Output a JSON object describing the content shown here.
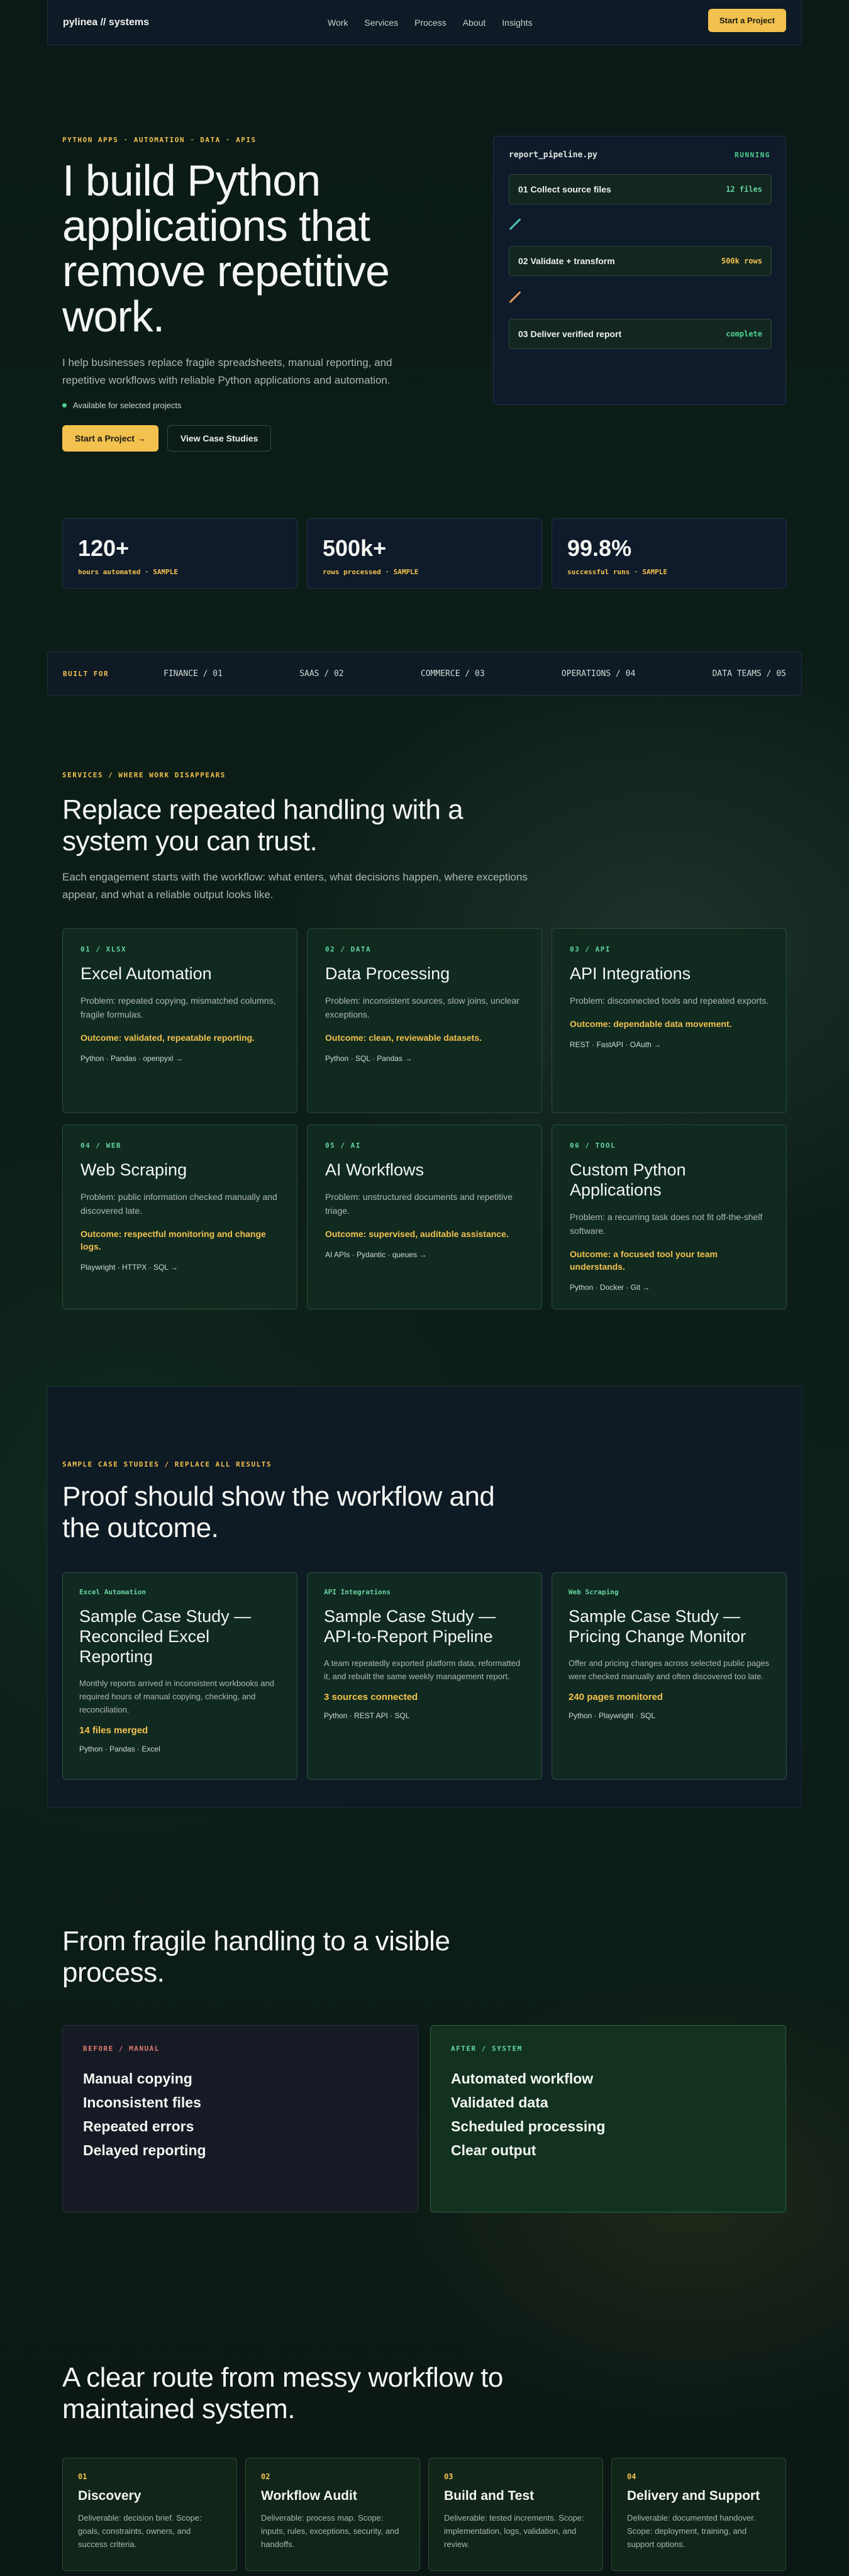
{
  "nav": {
    "brand": "pylinea // systems",
    "links": [
      "Work",
      "Services",
      "Process",
      "About",
      "Insights"
    ],
    "cta": "Start a Project"
  },
  "hero": {
    "eyebrow": "PYTHON APPS · AUTOMATION · DATA · APIS",
    "title": "I build Python applications that remove repetitive work.",
    "lead": "I help businesses replace fragile spreadsheets, manual reporting, and repetitive workflows with reliable Python applications and automation.",
    "availability": "Available for selected projects",
    "cta_primary": "Start a Project →",
    "cta_secondary": "View Case Studies"
  },
  "pipeline": {
    "filename": "report_pipeline.py",
    "status": "RUNNING",
    "steps": [
      {
        "label": "01 Collect source files",
        "meta": "12 files",
        "color": "#64d4a0"
      },
      {
        "label": "02 Validate + transform",
        "meta": "500k rows",
        "color": "#f2c14e"
      },
      {
        "label": "03 Deliver verified report",
        "meta": "complete",
        "color": "#4fd28f"
      }
    ],
    "connector_colors": [
      "#4fc6b6",
      "#e39a5a"
    ]
  },
  "stats": [
    {
      "value": "120+",
      "label": "hours automated · SAMPLE"
    },
    {
      "value": "500k+",
      "label": "rows processed · SAMPLE"
    },
    {
      "value": "99.8%",
      "label": "successful runs · SAMPLE"
    }
  ],
  "built_for": {
    "label": "BUILT FOR",
    "items": [
      "FINANCE / 01",
      "SAAS / 02",
      "COMMERCE / 03",
      "OPERATIONS / 04",
      "DATA TEAMS / 05"
    ]
  },
  "services_section": {
    "eyebrow": "SERVICES / WHERE WORK DISAPPEARS",
    "title": "Replace repeated handling with a system you can trust.",
    "lead": "Each engagement starts with the workflow: what enters, what decisions happen, where exceptions appear, and what a reliable output looks like.",
    "cards": [
      {
        "num": "01 / XLSX",
        "title": "Excel Automation",
        "problem": "Problem: repeated copying, mismatched columns, fragile formulas.",
        "outcome": "Outcome: validated, repeatable reporting.",
        "stack": "Python · Pandas · openpyxl →"
      },
      {
        "num": "02 / DATA",
        "title": "Data Processing",
        "problem": "Problem: inconsistent sources, slow joins, unclear exceptions.",
        "outcome": "Outcome: clean, reviewable datasets.",
        "stack": "Python · SQL · Pandas →"
      },
      {
        "num": "03 / API",
        "title": "API Integrations",
        "problem": "Problem: disconnected tools and repeated exports.",
        "outcome": "Outcome: dependable data movement.",
        "stack": "REST · FastAPI · OAuth →"
      },
      {
        "num": "04 / WEB",
        "title": "Web Scraping",
        "problem": "Problem: public information checked manually and discovered late.",
        "outcome": "Outcome: respectful monitoring and change logs.",
        "stack": "Playwright · HTTPX · SQL →"
      },
      {
        "num": "05 / AI",
        "title": "AI Workflows",
        "problem": "Problem: unstructured documents and repetitive triage.",
        "outcome": "Outcome: supervised, auditable assistance.",
        "stack": "AI APIs · Pydantic · queues →"
      },
      {
        "num": "06 / TOOL",
        "title": "Custom Python Applications",
        "problem": "Problem: a recurring task does not fit off-the-shelf software.",
        "outcome": "Outcome: a focused tool your team understands.",
        "stack": "Python · Docker · Git →"
      }
    ]
  },
  "case_section": {
    "eyebrow": "SAMPLE CASE STUDIES / REPLACE ALL RESULTS",
    "title": "Proof should show the workflow and the outcome.",
    "cards": [
      {
        "tag": "Excel Automation",
        "title": "Sample Case Study — Reconciled Excel Reporting",
        "desc": "Monthly reports arrived in inconsistent workbooks and required hours of manual copying, checking, and reconciliation.",
        "result": "14 files merged",
        "stack": "Python · Pandas · Excel"
      },
      {
        "tag": "API Integrations",
        "title": "Sample Case Study — API-to-Report Pipeline",
        "desc": "A team repeatedly exported platform data, reformatted it, and rebuilt the same weekly management report.",
        "result": "3 sources connected",
        "stack": "Python · REST API · SQL"
      },
      {
        "tag": "Web Scraping",
        "title": "Sample Case Study — Pricing Change Monitor",
        "desc": "Offer and pricing changes across selected public pages were checked manually and often discovered too late.",
        "result": "240 pages monitored",
        "stack": "Python · Playwright · SQL"
      }
    ]
  },
  "compare": {
    "title": "From fragile handling to a visible process.",
    "before": {
      "label": "BEFORE / MANUAL",
      "items": [
        "Manual copying",
        "Inconsistent files",
        "Repeated errors",
        "Delayed reporting"
      ]
    },
    "after": {
      "label": "AFTER / SYSTEM",
      "items": [
        "Automated workflow",
        "Validated data",
        "Scheduled processing",
        "Clear output"
      ]
    }
  },
  "process": {
    "title": "A clear route from messy workflow to maintained system.",
    "steps": [
      {
        "num": "01",
        "title": "Discovery",
        "desc": "Deliverable: decision brief. Scope: goals, constraints, owners, and success criteria."
      },
      {
        "num": "02",
        "title": "Workflow Audit",
        "desc": "Deliverable: process map. Scope: inputs, rules, exceptions, security, and handoffs."
      },
      {
        "num": "03",
        "title": "Build and Test",
        "desc": "Deliverable: tested increments. Scope: implementation, logs, validation, and review."
      },
      {
        "num": "04",
        "title": "Delivery and Support",
        "desc": "Deliverable: documented handover. Scope: deployment, training, and support options."
      }
    ]
  }
}
